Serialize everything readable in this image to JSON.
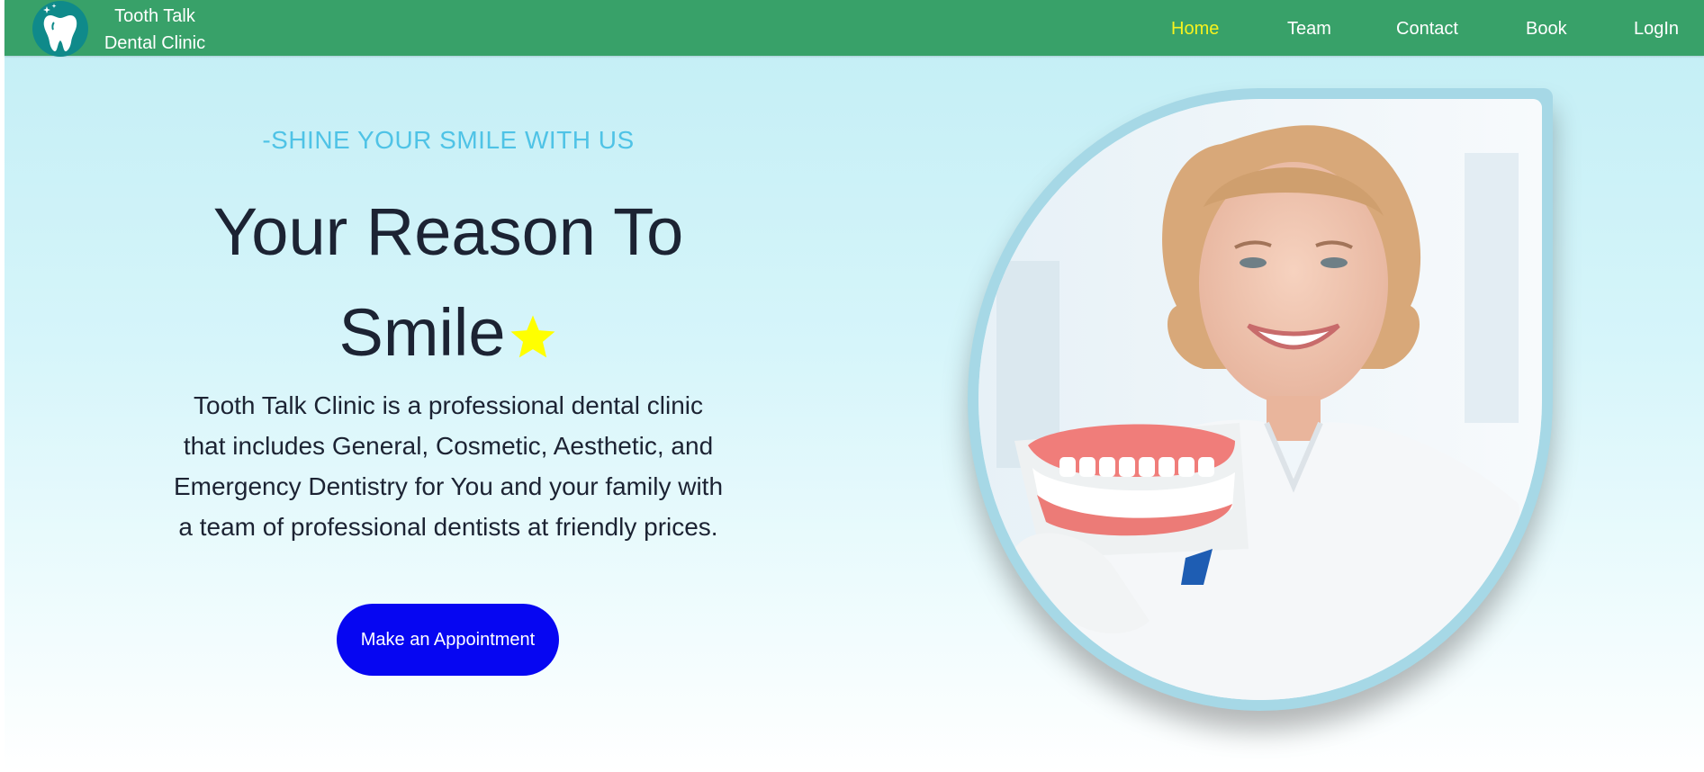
{
  "navbar": {
    "brand_line1": "Tooth Talk",
    "brand_line2": "Dental Clinic",
    "logo_icon": "tooth-icon",
    "items": [
      {
        "label": "Home",
        "active": true
      },
      {
        "label": "Team",
        "active": false
      },
      {
        "label": "Contact",
        "active": false
      },
      {
        "label": "Book",
        "active": false
      },
      {
        "label": "LogIn",
        "active": false
      }
    ]
  },
  "hero": {
    "tagline": "-SHINE YOUR SMILE WITH US",
    "headline_line1": "Your Reason To",
    "headline_line2": "Smile",
    "headline_icon": "star-icon",
    "description": "Tooth Talk Clinic is a professional dental clinic that includes General, Cosmetic, Aesthetic, and Emergency Dentistry for You and your family with a team of professional dentists at friendly prices.",
    "cta_label": "Make an Appointment",
    "image_icon": "dentist-photo"
  },
  "colors": {
    "navbar_bg": "#38a169",
    "nav_active": "#f6f31e",
    "tagline": "#4fc3e6",
    "cta_bg": "#0606f2",
    "star": "#ffff00",
    "frame": "#a6d8e6"
  }
}
